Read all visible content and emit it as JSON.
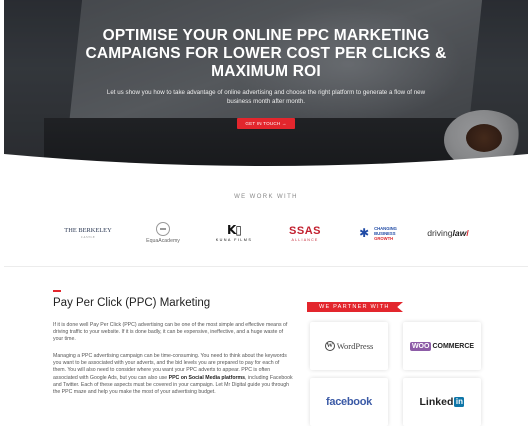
{
  "hero": {
    "title_line1": "OPTIMISE YOUR ONLINE PPC MARKETING",
    "title_line2": "CAMPAIGNS FOR LOWER COST PER CLICKS &",
    "title_line3": "MAXIMUM ROI",
    "subtitle": "Let us show you how to take advantage of online advertising and choose the right platform to generate a flow of new business month after month.",
    "cta_label": "GET IN TOUCH →"
  },
  "work_with": {
    "title": "WE WORK WITH",
    "logos": {
      "berkeley": "THE BERKELEY",
      "berkeley_sub": "CASTLE",
      "equa": "EquaAcademy",
      "kuna_mark": "K▯",
      "kuna_sub": "KUNA FILMS",
      "ssas": "SSAS",
      "ssas_sub": "ALLIANCE",
      "cb_l1": "CHANGING",
      "cb_l2": "BUSINESS",
      "cb_l3": "GROWTH",
      "dl_pre": "driving",
      "dl_bold": "law",
      "dl_slash": "/"
    }
  },
  "ppc": {
    "title": "Pay Per Click (PPC) Marketing",
    "p1": "If it is done well Pay Per Click (PPC) advertising can be one of the most simple and effective means of driving traffic to your website. If it is done badly, it can be expensive, ineffective, and a huge waste of your time.",
    "p2_a": "Managing a PPC advertising campaign can be time-consuming. You need to think about the keywords you want to be associated with your adverts, and the bid levels you are prepared to pay for each of them. You will also need to consider where you want your PPC adverts to appear. PPC is often associated with Google Ads, but you can also use ",
    "p2_bold": "PPC on Social Media platforms",
    "p2_b": ", including Facebook and Twitter. Each of these aspects must be covered in your campaign. Let Mr Digital guide you through the PPC maze and help you make the most of your advertising budget."
  },
  "partners": {
    "tag": "WE PARTNER WITH",
    "wordpress": "WordPress",
    "woo_bubble": "WOO",
    "woo_rest": "COMMERCE",
    "facebook": "facebook",
    "linked": "Linked",
    "in": "in"
  },
  "colors": {
    "accent": "#e3262d",
    "facebook": "#3b5aa6",
    "linkedin": "#0e76a8",
    "woo": "#8d5ca7"
  }
}
